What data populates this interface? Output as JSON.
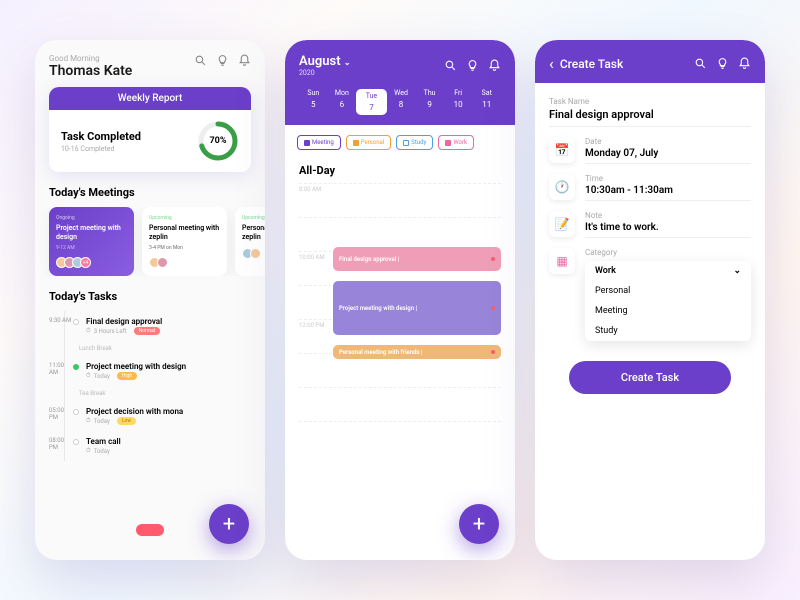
{
  "colors": {
    "primary": "#6b3fc9",
    "accent": "#ff5a6e"
  },
  "home": {
    "greeting": "Good Morning",
    "username": "Thomas Kate",
    "report": {
      "header": "Weekly Report",
      "title": "Task Completed",
      "subtitle": "10-16 Completed",
      "percent": "70%",
      "value": 70
    },
    "meetings_title": "Today's Meetings",
    "meetings": [
      {
        "status": "Ongoing",
        "title": "Project meeting with design",
        "time": "9-12 AM",
        "more": "+4"
      },
      {
        "status": "Upcoming",
        "title": "Personal meeting with zeplin",
        "time": "3-4 PM on Mon"
      },
      {
        "status": "Upcoming",
        "title": "Personal meeting with zeplin",
        "time": ""
      }
    ],
    "tasks_title": "Today's Tasks",
    "breaks": {
      "lunch": "Lunch Break",
      "tea": "Tea Break"
    },
    "tasks": [
      {
        "time": "9:30 AM",
        "name": "Final design approval",
        "meta": "3 Hours Left",
        "badge": "Normal"
      },
      {
        "time": "11:00 AM",
        "name": "Project meeting with design",
        "meta": "Today",
        "badge": "High",
        "active": true
      },
      {
        "time": "05:00 PM",
        "name": "Project decision with mona",
        "meta": "Today",
        "badge": "Low"
      },
      {
        "time": "08:00 PM",
        "name": "Team call",
        "meta": "Today"
      }
    ]
  },
  "calendar": {
    "month": "August",
    "year": "2020",
    "days": [
      {
        "label": "Sun",
        "num": "5"
      },
      {
        "label": "Mon",
        "num": "6"
      },
      {
        "label": "Tue",
        "num": "7",
        "selected": true
      },
      {
        "label": "Wed",
        "num": "8"
      },
      {
        "label": "Thu",
        "num": "9"
      },
      {
        "label": "Fri",
        "num": "10"
      },
      {
        "label": "Sat",
        "num": "11"
      }
    ],
    "categories": [
      {
        "label": "Meeting",
        "color": "#6b3fc9",
        "checked": true
      },
      {
        "label": "Personal",
        "color": "#f0a030",
        "checked": true
      },
      {
        "label": "Study",
        "color": "#4aa0e8",
        "checked": false
      },
      {
        "label": "Work",
        "color": "#e86aa0",
        "checked": true
      }
    ],
    "allday": "All-Day",
    "slots": [
      "8:00 AM",
      "",
      "10:00 AM",
      "",
      "12:00 PM",
      "",
      "",
      ""
    ],
    "events": [
      {
        "title": "Final design approval |",
        "class": "pink"
      },
      {
        "title": "Project meeting with design |",
        "class": "purple"
      },
      {
        "title": "Personal meeting with friends |",
        "class": "orange"
      }
    ]
  },
  "form": {
    "title": "Create Task",
    "task_label": "Task Name",
    "task_value": "Final design approval",
    "date_label": "Date",
    "date_value": "Monday 07, July",
    "time_label": "Time",
    "time_value": "10:30am - 11:30am",
    "note_label": "Note",
    "note_value": "It's time to work.",
    "cat_label": "Category",
    "cat_options": [
      "Work",
      "Personal",
      "Meeting",
      "Study"
    ],
    "button": "Create Task"
  }
}
